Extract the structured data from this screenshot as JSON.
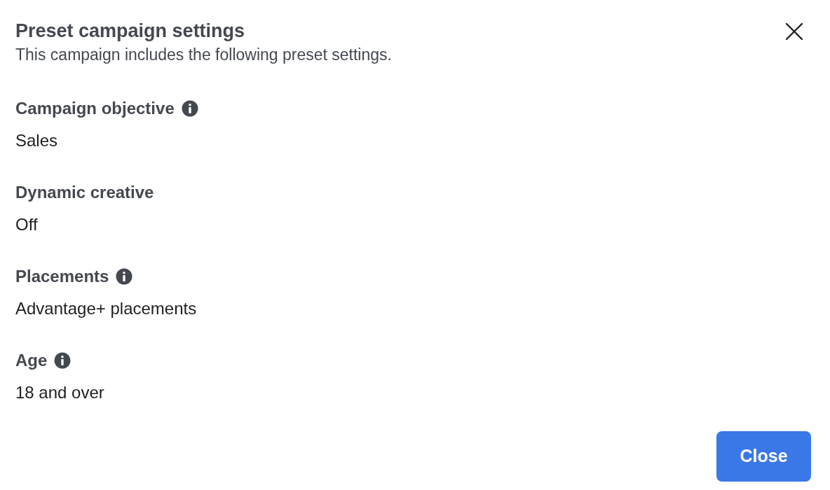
{
  "dialog": {
    "title": "Preset campaign settings",
    "subtitle": "This campaign includes the following preset settings."
  },
  "settings": [
    {
      "label": "Campaign objective",
      "info": true,
      "value": "Sales"
    },
    {
      "label": "Dynamic creative",
      "info": false,
      "value": "Off"
    },
    {
      "label": "Placements",
      "info": true,
      "value": "Advantage+ placements"
    },
    {
      "label": "Age",
      "info": true,
      "value": "18 and over"
    }
  ],
  "buttons": [
    "Close"
  ]
}
